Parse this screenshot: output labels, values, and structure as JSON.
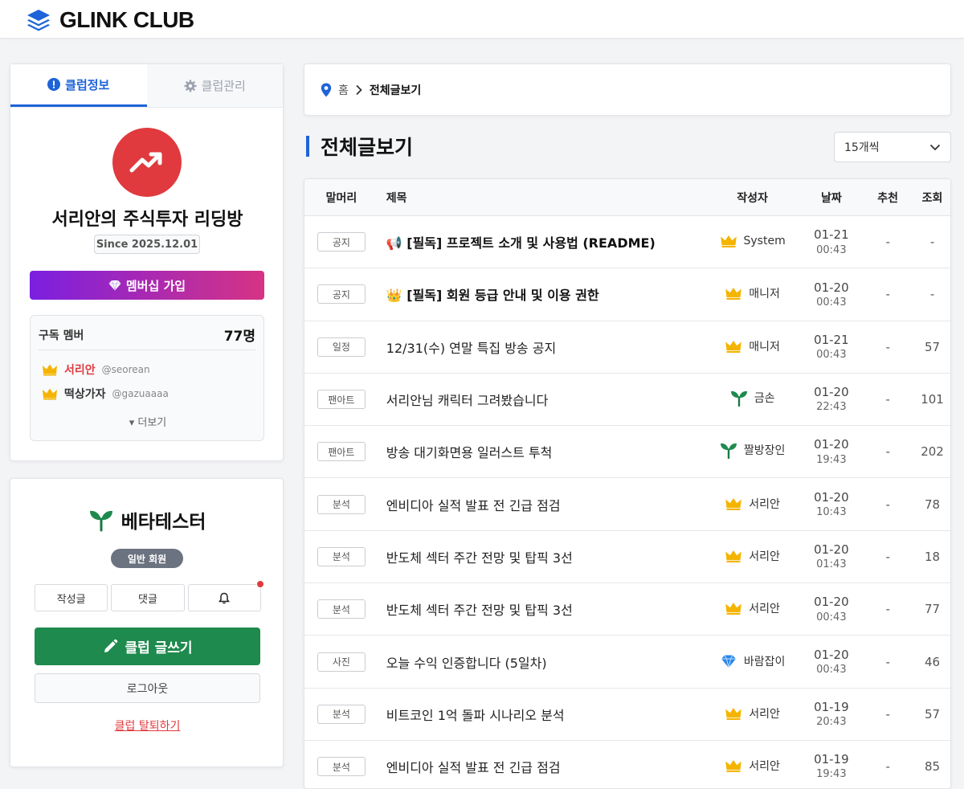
{
  "header": {
    "brand": "GLINK CLUB"
  },
  "club": {
    "tabs": [
      {
        "label": "클럽정보"
      },
      {
        "label": "클럽관리"
      }
    ],
    "name": "서리안의 주식투자 리딩방",
    "since": "Since 2025.12.01",
    "join_label": "멤버십 가입",
    "members_label": "구독 멤버",
    "members_count": "77명",
    "members": [
      {
        "name": "서리안",
        "handle": "@seorean",
        "color": "#e03a3e"
      },
      {
        "name": "떡상가자",
        "handle": "@gazuaaaa",
        "color": "#333333"
      }
    ],
    "more_label": "▾ 더보기"
  },
  "user": {
    "name": "베타테스터",
    "grade": "일반 회원",
    "posts_label": "작성글",
    "comments_label": "댓글",
    "write_label": "클럽 글쓰기",
    "logout_label": "로그아웃",
    "leave_label": "클럽 탈퇴하기"
  },
  "breadcrumb": {
    "home": "홈",
    "current": "전체글보기"
  },
  "page": {
    "title": "전체글보기",
    "per_page": "15개씩"
  },
  "table": {
    "headers": {
      "category": "말머리",
      "title": "제목",
      "author": "작성자",
      "date": "날짜",
      "rec": "추천",
      "views": "조회"
    },
    "rows": [
      {
        "category": "공지",
        "title": "📢 [필독] 프로젝트 소개 및 사용법 (README)",
        "bold": true,
        "author": "System",
        "author_icon": "crown-icon",
        "date": "01-21",
        "time": "00:43",
        "rec": "-",
        "views": "-"
      },
      {
        "category": "공지",
        "title": "👑 [필독] 회원 등급 안내 및 이용 권한",
        "bold": true,
        "author": "매니저",
        "author_icon": "crown-icon",
        "date": "01-20",
        "time": "00:43",
        "rec": "-",
        "views": "-"
      },
      {
        "category": "일정",
        "title": "12/31(수) 연말 특집 방송 공지",
        "bold": false,
        "author": "매니저",
        "author_icon": "crown-icon",
        "date": "01-21",
        "time": "00:43",
        "rec": "-",
        "views": "57"
      },
      {
        "category": "팬아트",
        "title": "서리안님 캐릭터 그려봤습니다",
        "bold": false,
        "author": "금손",
        "author_icon": "sprout-icon",
        "date": "01-20",
        "time": "22:43",
        "rec": "-",
        "views": "101"
      },
      {
        "category": "팬아트",
        "title": "방송 대기화면용 일러스트 투척",
        "bold": false,
        "author": "짤방장인",
        "author_icon": "sprout-icon",
        "date": "01-20",
        "time": "19:43",
        "rec": "-",
        "views": "202"
      },
      {
        "category": "분석",
        "title": "엔비디아 실적 발표 전 긴급 점검",
        "bold": false,
        "author": "서리안",
        "author_icon": "crown-icon",
        "date": "01-20",
        "time": "10:43",
        "rec": "-",
        "views": "78"
      },
      {
        "category": "분석",
        "title": "반도체 섹터 주간 전망 및 탑픽 3선",
        "bold": false,
        "author": "서리안",
        "author_icon": "crown-icon",
        "date": "01-20",
        "time": "01:43",
        "rec": "-",
        "views": "18"
      },
      {
        "category": "분석",
        "title": "반도체 섹터 주간 전망 및 탑픽 3선",
        "bold": false,
        "author": "서리안",
        "author_icon": "crown-icon",
        "date": "01-20",
        "time": "00:43",
        "rec": "-",
        "views": "77"
      },
      {
        "category": "사진",
        "title": "오늘 수익 인증합니다 (5일차)",
        "bold": false,
        "author": "바람잡이",
        "author_icon": "diamond-icon",
        "date": "01-20",
        "time": "00:43",
        "rec": "-",
        "views": "46"
      },
      {
        "category": "분석",
        "title": "비트코인 1억 돌파 시나리오 분석",
        "bold": false,
        "author": "서리안",
        "author_icon": "crown-icon",
        "date": "01-19",
        "time": "20:43",
        "rec": "-",
        "views": "57"
      },
      {
        "category": "분석",
        "title": "엔비디아 실적 발표 전 긴급 점검",
        "bold": false,
        "author": "서리안",
        "author_icon": "crown-icon",
        "date": "01-19",
        "time": "19:43",
        "rec": "-",
        "views": "85"
      }
    ]
  },
  "colors": {
    "accent": "#1e63d8",
    "logo_bg": "#e03a3e",
    "write_btn": "#1f8a4e",
    "crown": "#f5b400"
  }
}
